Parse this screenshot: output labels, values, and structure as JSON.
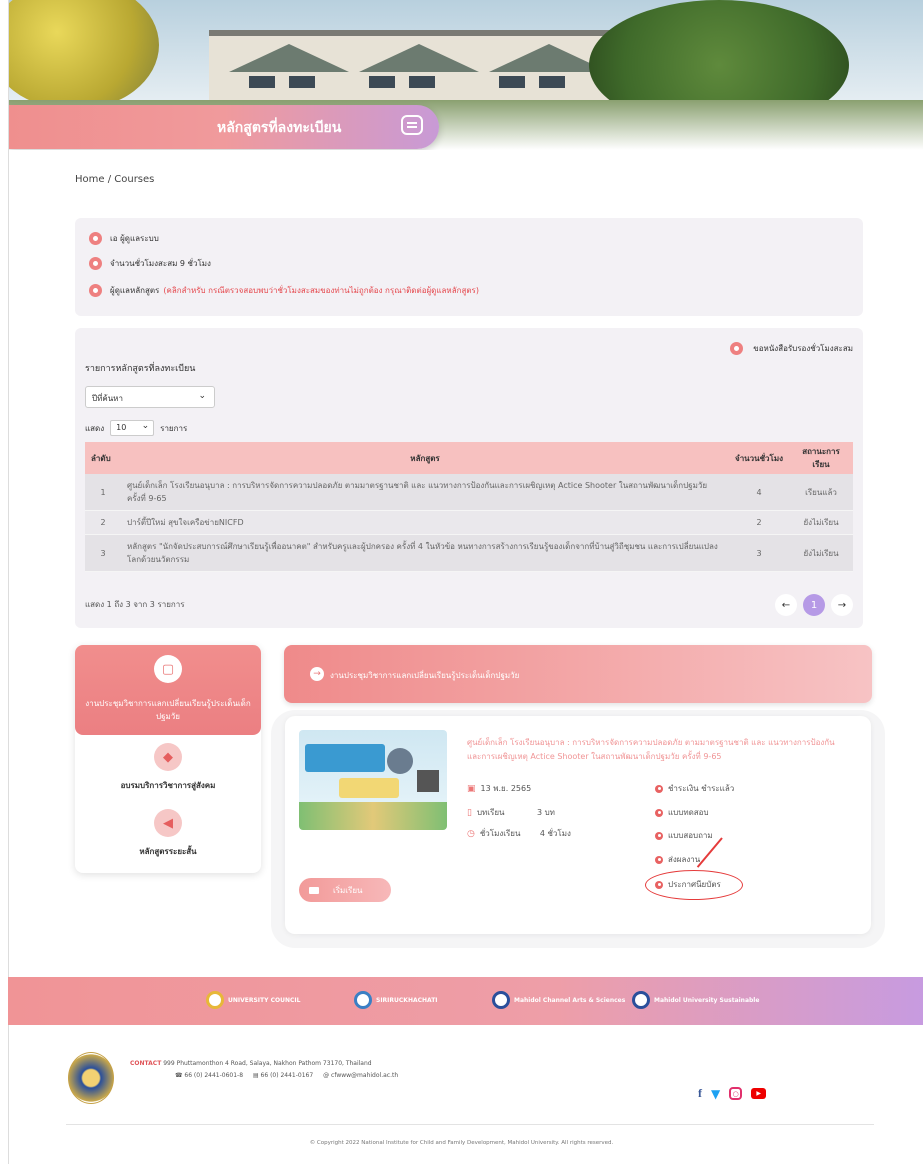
{
  "page_title": "หลักสูตรที่ลงทะเบียน",
  "breadcrumb": "Home / Courses",
  "info": {
    "user": "เอ ผู้ดูแลระบบ",
    "hours": "จำนวนชั่วโมงสะสม 9 ชั่วโมง",
    "admin_label": "ผู้ดูแลหลักสูตร",
    "admin_note": "(คลิกสำหรับ กรณีตรวจสอบพบว่าชั่วโมงสะสมของท่านไม่ถูกต้อง กรุณาติดต่อผู้ดูแลหลักสูตร)"
  },
  "list": {
    "request_cert": "ขอหนังสือรับรองชั่วโมงสะสม",
    "label": "รายการหลักสูตรที่ลงทะเบียน",
    "year_select": "ปีที่ค้นหา",
    "show_prefix": "แสดง",
    "show_value": "10",
    "show_suffix": "รายการ",
    "headers": {
      "no": "ลำดับ",
      "course": "หลักสูตร",
      "hours": "จำนวนชั่วโมง",
      "status": "สถานะการเรียน"
    },
    "rows": [
      {
        "no": "1",
        "course": "ศูนย์เด็กเล็ก โรงเรียนอนุบาล : การบริหารจัดการความปลอดภัย ตามมาตรฐานชาติ และ แนวทางการป้องกันและการเผชิญเหตุ Actice Shooter ในสถานพัฒนาเด็กปฐมวัย ครั้งที่ 9-65",
        "hours": "4",
        "status": "เรียนแล้ว"
      },
      {
        "no": "2",
        "course": "ปาร์ตี้ปีใหม่ สุขใจเครือข่ายNICFD",
        "hours": "2",
        "status": "ยังไม่เรียน"
      },
      {
        "no": "3",
        "course": "หลักสูตร \"นักจัดประสบการณ์ศึกษาเรียนรู้เพื่ออนาคต\" สำหรับครูและผู้ปกครอง ครั้งที่ 4 ในหัวข้อ หนทางการสร้างการเรียนรู้ของเด็กจากที่บ้านสู่วิถีชุมชน และการเปลี่ยนแปลงโลกด้วยนวัตกรรม",
        "hours": "3",
        "status": "ยังไม่เรียน"
      }
    ],
    "footer_text": "แสดง 1 ถึง 3 จาก 3 รายการ",
    "page_prev": "←",
    "page_current": "1",
    "page_next": "→"
  },
  "categories": [
    {
      "label": "งานประชุมวิชาการแลกเปลี่ยนเรียนรู้ประเด็นเด็กปฐมวัย",
      "icon": "chat-icon"
    },
    {
      "label": "อบรมบริการวิชาการสู่สังคม",
      "icon": "box-icon"
    },
    {
      "label": "หลักสูตรระยะสั้น",
      "icon": "megaphone-icon"
    }
  ],
  "section_title": "งานประชุมวิชาการแลกเปลี่ยนเรียนรู้ประเด็นเด็กปฐมวัย",
  "course": {
    "title": "ศูนย์เด็กเล็ก โรงเรียนอนุบาล : การบริหารจัดการความปลอดภัย ตามมาตรฐานชาติ และ แนวทางการป้องกันและการเผชิญเหตุ Actice Shooter ในสถานพัฒนาเด็กปฐมวัย ครั้งที่ 9-65",
    "date": "13 พ.ย. 2565",
    "lessons_label": "บทเรียน",
    "lessons_value": "3 บท",
    "duration_label": "ชั่วโมงเรียน",
    "duration_value": "4 ชั่วโมง",
    "status_items": [
      "ชำระเงิน ชำระแล้ว",
      "แบบทดสอบ",
      "แบบสอบถาม",
      "ส่งผลงาน",
      "ประกาศนียบัตร"
    ],
    "start_button": "เริ่มเรียน"
  },
  "footer": {
    "logos": [
      "UNIVERSITY COUNCIL",
      "SIRIRUCKHACHATI",
      "Mahidol Channel Arts & Sciences",
      "Mahidol University Sustainable"
    ],
    "contact_label": "CONTACT",
    "address": "999 Phuttamonthon 4 Road, Salaya, Nakhon Pathom 73170, Thailand",
    "phone": "66 (0) 2441-0601-8",
    "fax": "66 (0) 2441-0167",
    "email": "cfwww@mahidol.ac.th",
    "copyright": "© Copyright 2022 National Institute for Child and Family Development, Mahidol University. All rights reserved."
  },
  "colors": {
    "accent": "#ee8080",
    "accent_purple": "#b69ae6",
    "annotation": "#e53b3b"
  }
}
